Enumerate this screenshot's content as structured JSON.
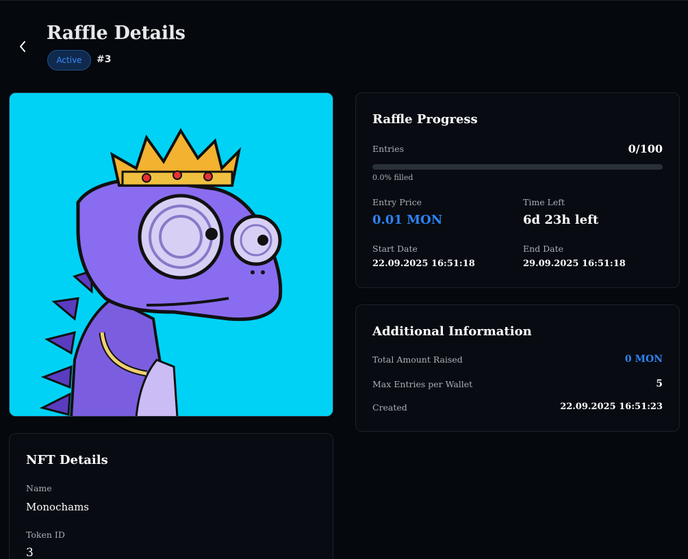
{
  "header": {
    "title": "Raffle Details",
    "status": "Active",
    "raffle_number": "#3"
  },
  "colors": {
    "accent": "#2f83f5",
    "background": "#05080d",
    "image_background": "#00d2f5",
    "badge_bg": "#0f2a4d"
  },
  "icons": {
    "back": "chevron-left-icon"
  },
  "progress": {
    "title": "Raffle Progress",
    "entries_label": "Entries",
    "entries_value": "0/100",
    "fill_fraction": 0,
    "filled_text": "0.0% filled",
    "entry_price_label": "Entry Price",
    "entry_price_value": "0.01 MON",
    "time_left_label": "Time Left",
    "time_left_value": "6d 23h left",
    "start_date_label": "Start Date",
    "start_date_value": "22.09.2025 16:51:18",
    "end_date_label": "End Date",
    "end_date_value": "29.09.2025 16:51:18"
  },
  "additional": {
    "title": "Additional Information",
    "rows": [
      {
        "label": "Total Amount Raised",
        "value": "0 MON"
      },
      {
        "label": "Max Entries per Wallet",
        "value": "5"
      },
      {
        "label": "Created",
        "value": "22.09.2025 16:51:23"
      }
    ]
  },
  "nft": {
    "title": "NFT Details",
    "name_label": "Name",
    "name_value": "Monochams",
    "token_label": "Token ID",
    "token_value": "3"
  }
}
